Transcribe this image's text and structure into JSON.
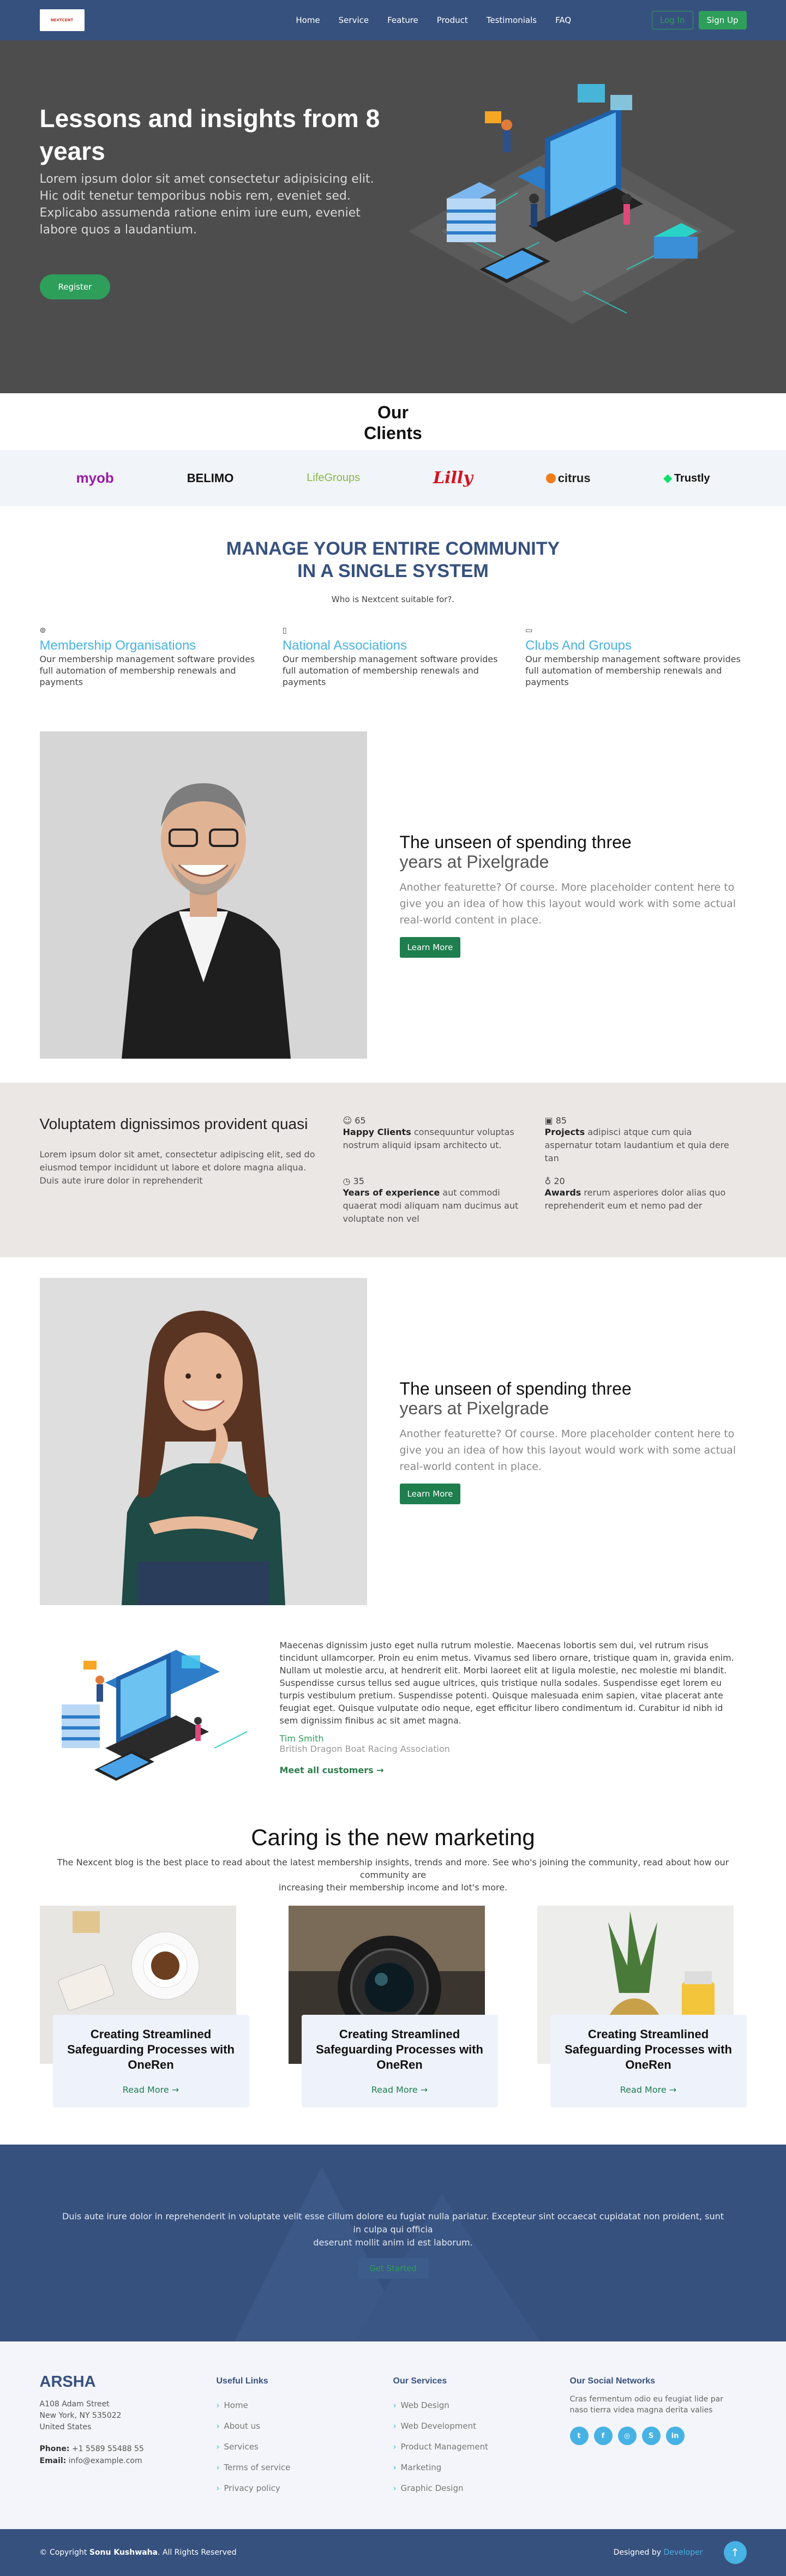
{
  "header": {
    "logo_text": "NEXTCENT",
    "nav": [
      "Home",
      "Service",
      "Feature",
      "Product",
      "Testimonials",
      "FAQ"
    ],
    "login": "Log In",
    "signup": "Sign Up"
  },
  "hero": {
    "title": "Lessons and insights from 8 years",
    "text": "Lorem ipsum dolor sit amet consectetur adipisicing elit. Hic odit tenetur temporibus nobis rem, eveniet sed. Explicabo assumenda ratione enim iure eum, eveniet labore quos a laudantium.",
    "register": "Register"
  },
  "clients": {
    "title_line1": "Our",
    "title_line2": "Clients",
    "logos": [
      "myob",
      "BELIMO",
      "LifeGroups",
      "Lilly",
      "citrus",
      "Trustly"
    ]
  },
  "manage": {
    "title_line1": "MANAGE YOUR ENTIRE COMMUNITY",
    "title_line2": "IN A SINGLE SYSTEM",
    "subtitle": "Who is Nextcent suitable for?.",
    "features": [
      {
        "title": "Membership Organisations",
        "text": "Our membership management software provides full automation of membership renewals and payments"
      },
      {
        "title": "National Associations",
        "text": "Our membership management software provides full automation of membership renewals and payments"
      },
      {
        "title": "Clubs And Groups",
        "text": "Our membership management software provides full automation of membership renewals and payments"
      }
    ]
  },
  "feature1": {
    "heading": "The unseen of spending three",
    "heading_muted": "years at Pixelgrade",
    "text": "Another featurette? Of course. More placeholder content here to give you an idea of how this layout would work with some actual real-world content in place.",
    "button": "Learn More"
  },
  "stats": {
    "heading": "Voluptatem dignissimos provident quasi",
    "text": "Lorem ipsum dolor sit amet, consectetur adipiscing elit, sed do eiusmod tempor incididunt ut labore et dolore magna aliqua. Duis aute irure dolor in reprehenderit",
    "items": [
      {
        "num": "65",
        "label": "Happy Clients",
        "text": "consequuntur voluptas nostrum aliquid ipsam architecto ut."
      },
      {
        "num": "85",
        "label": "Projects",
        "text": "adipisci atque cum quia aspernatur totam laudantium et quia dere tan"
      },
      {
        "num": "35",
        "label": "Years of experience",
        "text": "aut commodi quaerat modi aliquam nam ducimus aut voluptate non vel"
      },
      {
        "num": "20",
        "label": "Awards",
        "text": "rerum asperiores dolor alias quo reprehenderit eum et nemo pad der"
      }
    ]
  },
  "feature2": {
    "heading": "The unseen of spending three",
    "heading_muted": "years at Pixelgrade",
    "text": "Another featurette? Of course. More placeholder content here to give you an idea of how this layout would work with some actual real-world content in place.",
    "button": "Learn More"
  },
  "testimonial": {
    "text": "Maecenas dignissim justo eget nulla rutrum molestie. Maecenas lobortis sem dui, vel rutrum risus tincidunt ullamcorper. Proin eu enim metus. Vivamus sed libero ornare, tristique quam in, gravida enim. Nullam ut molestie arcu, at hendrerit elit. Morbi laoreet elit at ligula molestie, nec molestie mi blandit. Suspendisse cursus tellus sed augue ultrices, quis tristique nulla sodales. Suspendisse eget lorem eu turpis vestibulum pretium. Suspendisse potenti. Quisque malesuada enim sapien, vitae placerat ante feugiat eget. Quisque vulputate odio neque, eget efficitur libero condimentum id. Curabitur id nibh id sem dignissim finibus ac sit amet magna.",
    "name": "Tim Smith",
    "org": "British Dragon Boat Racing Association",
    "link": "Meet all customers →"
  },
  "blog": {
    "title": "Caring is the new marketing",
    "desc_line1": "The Nexcent blog is the best place to read about the latest membership insights, trends and more. See who's joining the community, read about how our community are",
    "desc_line2": "increasing their membership income and lot's more.",
    "cards": [
      {
        "title": "Creating Streamlined Safeguarding Processes with OneRen",
        "more": "Read More →"
      },
      {
        "title": "Creating Streamlined Safeguarding Processes with OneRen",
        "more": "Read More →"
      },
      {
        "title": "Creating Streamlined Safeguarding Processes with OneRen",
        "more": "Read More →"
      }
    ]
  },
  "cta": {
    "text_line1": "Duis aute irure dolor in reprehenderit in voluptate velit esse cillum dolore eu fugiat nulla pariatur. Excepteur sint occaecat cupidatat non proident, sunt in culpa qui officia",
    "text_line2": "deserunt mollit anim id est laborum.",
    "button": "Get Started"
  },
  "footer": {
    "brand": "ARSHA",
    "address": [
      "A108 Adam Street",
      "New York, NY 535022",
      "United States"
    ],
    "phone_label": "Phone:",
    "phone": "+1 5589 55488 55",
    "email_label": "Email:",
    "email": "info@example.com",
    "useful_title": "Useful Links",
    "useful": [
      "Home",
      "About us",
      "Services",
      "Terms of service",
      "Privacy policy"
    ],
    "services_title": "Our Services",
    "services": [
      "Web Design",
      "Web Development",
      "Product Management",
      "Marketing",
      "Graphic Design"
    ],
    "social_title": "Our Social Networks",
    "social_text": "Cras fermentum odio eu feugiat lide par naso tierra videa magna derita valies",
    "social_icons": [
      "twitter-icon",
      "facebook-icon",
      "instagram-icon",
      "skype-icon",
      "linkedin-icon"
    ]
  },
  "bottom": {
    "copyright_prefix": "© Copyright",
    "copyright_name": "Sonu Kushwaha",
    "copyright_suffix": ". All Rights Reserved",
    "designed_by": "Designed by",
    "designer": "Developer"
  },
  "colors": {
    "navy": "#37517e",
    "green": "#2e9e5b",
    "sky": "#47b2e4"
  }
}
